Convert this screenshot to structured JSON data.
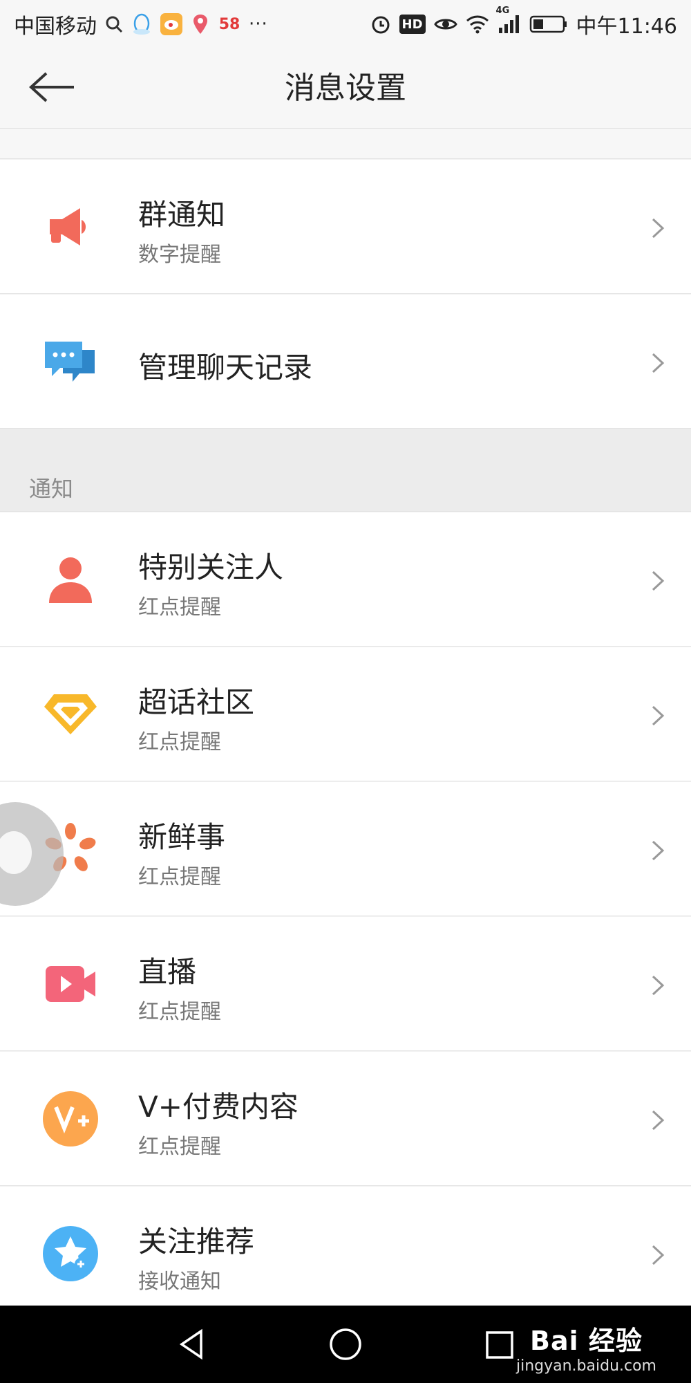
{
  "status_bar": {
    "carrier": "中国移动",
    "network": "4G",
    "time": "中午11:46",
    "icons": [
      "search-icon",
      "qq-icon",
      "weibo-icon",
      "maps-icon",
      "58-app-icon",
      "more-icon",
      "alarm-icon",
      "hd-icon",
      "eye-icon",
      "wifi-icon",
      "signal-icon",
      "battery-icon"
    ],
    "app_58_label": "58",
    "more_label": "···",
    "hd_label": "HD"
  },
  "header": {
    "title": "消息设置",
    "back_icon": "back-arrow-icon"
  },
  "rows_top": [
    {
      "icon": "megaphone-icon",
      "title": "群通知",
      "subtitle": "数字提醒",
      "color": "#f26a5b"
    },
    {
      "icon": "chat-bubbles-icon",
      "title": "管理聊天记录",
      "subtitle": "",
      "color": "#4aa8e8"
    }
  ],
  "section": {
    "label": "通知"
  },
  "rows_notify": [
    {
      "icon": "person-icon",
      "title": "特别关注人",
      "subtitle": "红点提醒",
      "color": "#f26a5b"
    },
    {
      "icon": "diamond-icon",
      "title": "超话社区",
      "subtitle": "红点提醒",
      "color": "#f8b82a"
    },
    {
      "icon": "petals-icon",
      "title": "新鲜事",
      "subtitle": "红点提醒",
      "color": "#f07c4b"
    },
    {
      "icon": "video-camera-icon",
      "title": "直播",
      "subtitle": "红点提醒",
      "color": "#f3657a"
    },
    {
      "icon": "v-plus-icon",
      "title": "V+付费内容",
      "subtitle": "红点提醒",
      "color": "#fca64e"
    },
    {
      "icon": "star-plus-icon",
      "title": "关注推荐",
      "subtitle": "接收通知",
      "color": "#4cb2f5"
    }
  ],
  "nav_bar": {
    "icons": [
      "back-triangle-icon",
      "home-circle-icon",
      "recents-square-icon"
    ]
  },
  "watermark": {
    "main": "Bai 经验",
    "sub": "jingyan.baidu.com"
  }
}
